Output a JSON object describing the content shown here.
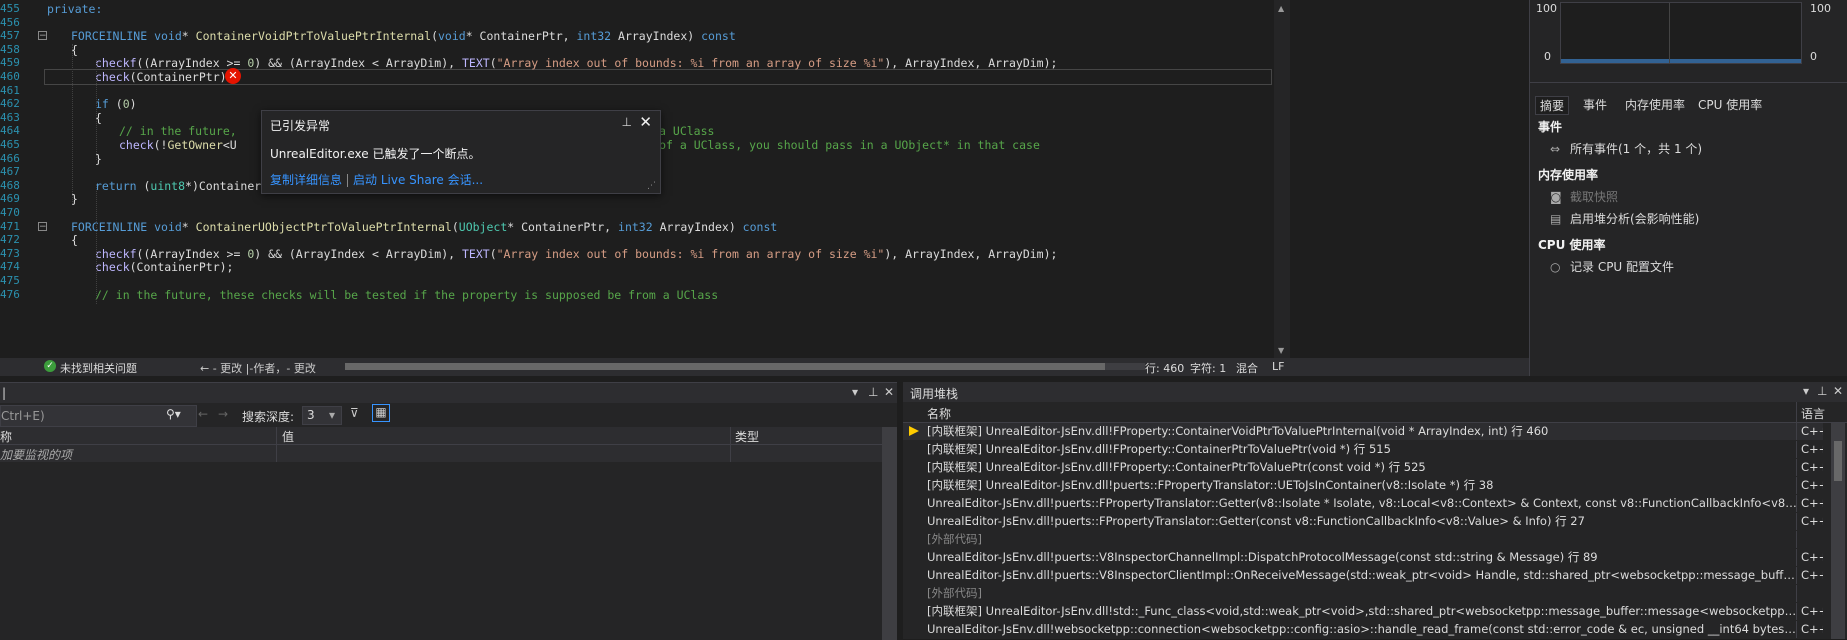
{
  "editor": {
    "line_numbers": [
      "455",
      "456",
      "457",
      "458",
      "459",
      "460",
      "461",
      "462",
      "463",
      "464",
      "465",
      "466",
      "467",
      "468",
      "469",
      "470",
      "471",
      "472",
      "473",
      "474",
      "475",
      "476"
    ],
    "lines": [
      {
        "indent": 0,
        "parts": [
          [
            "kw",
            "private:"
          ]
        ]
      },
      {
        "indent": 0,
        "parts": []
      },
      {
        "indent": 1,
        "parts": [
          [
            "kw",
            "FORCEINLINE "
          ],
          [
            "kw",
            "void"
          ],
          [
            "",
            "* "
          ],
          [
            "fn",
            "ContainerVoidPtrToValuePtrInternal"
          ],
          [
            "",
            "("
          ],
          [
            "kw",
            "void"
          ],
          [
            "",
            "* ContainerPtr, "
          ],
          [
            "kw",
            "int32"
          ],
          [
            "",
            " ArrayIndex) "
          ],
          [
            "kw",
            "const"
          ]
        ]
      },
      {
        "indent": 1,
        "parts": [
          [
            "",
            "{"
          ]
        ]
      },
      {
        "indent": 2,
        "parts": [
          [
            "mac",
            "checkf"
          ],
          [
            "",
            "((ArrayIndex >= "
          ],
          [
            "num",
            "0"
          ],
          [
            "",
            ") && (ArrayIndex < ArrayDim), "
          ],
          [
            "mac",
            "TEXT"
          ],
          [
            "",
            "("
          ],
          [
            "str",
            "\"Array index out of bounds: %i from an array of size %i\""
          ],
          [
            "",
            "), ArrayIndex, ArrayDim);"
          ]
        ]
      },
      {
        "indent": 2,
        "parts": [
          [
            "mac",
            "check"
          ],
          [
            "",
            "(ContainerPtr);"
          ]
        ]
      },
      {
        "indent": 0,
        "parts": []
      },
      {
        "indent": 2,
        "parts": [
          [
            "kw",
            "if"
          ],
          [
            "",
            " ("
          ],
          [
            "num",
            "0"
          ],
          [
            "",
            ")"
          ]
        ]
      },
      {
        "indent": 2,
        "parts": [
          [
            "",
            "{"
          ]
        ]
      },
      {
        "indent": 3,
        "parts": [
          [
            "cm",
            "// in the future, "
          ],
          [
            "",
            "                                                     "
          ],
          [
            "cm",
            "ive to a UClass"
          ]
        ]
      },
      {
        "indent": 3,
        "parts": [
          [
            "mac",
            "check"
          ],
          [
            "",
            "(!"
          ],
          [
            "fn",
            "GetOwner"
          ],
          [
            "",
            "<U"
          ],
          [
            "",
            "                                             "
          ],
          [
            "cm",
            " child property of a UClass, you should pass in a UObject* in that case"
          ]
        ]
      },
      {
        "indent": 2,
        "parts": [
          [
            "",
            "}"
          ]
        ]
      },
      {
        "indent": 0,
        "parts": []
      },
      {
        "indent": 2,
        "parts": [
          [
            "kw",
            "return"
          ],
          [
            "",
            " ("
          ],
          [
            "ty",
            "uint8"
          ],
          [
            "",
            "*)ContainerPtr + Offset_Internal + ElementSize * ArrayIndex;"
          ]
        ]
      },
      {
        "indent": 1,
        "parts": [
          [
            "",
            "}"
          ]
        ]
      },
      {
        "indent": 0,
        "parts": []
      },
      {
        "indent": 1,
        "parts": [
          [
            "kw",
            "FORCEINLINE "
          ],
          [
            "kw",
            "void"
          ],
          [
            "",
            "* "
          ],
          [
            "fn",
            "ContainerUObjectPtrToValuePtrInternal"
          ],
          [
            "",
            "("
          ],
          [
            "ty",
            "UObject"
          ],
          [
            "",
            "* ContainerPtr, "
          ],
          [
            "kw",
            "int32"
          ],
          [
            "",
            " ArrayIndex) "
          ],
          [
            "kw",
            "const"
          ]
        ]
      },
      {
        "indent": 1,
        "parts": [
          [
            "",
            "{"
          ]
        ]
      },
      {
        "indent": 2,
        "parts": [
          [
            "mac",
            "checkf"
          ],
          [
            "",
            "((ArrayIndex >= "
          ],
          [
            "num",
            "0"
          ],
          [
            "",
            ") && (ArrayIndex < ArrayDim), "
          ],
          [
            "mac",
            "TEXT"
          ],
          [
            "",
            "("
          ],
          [
            "str",
            "\"Array index out of bounds: %i from an array of size %i\""
          ],
          [
            "",
            "), ArrayIndex, ArrayDim);"
          ]
        ]
      },
      {
        "indent": 2,
        "parts": [
          [
            "mac",
            "check"
          ],
          [
            "",
            "(ContainerPtr);"
          ]
        ]
      },
      {
        "indent": 0,
        "parts": []
      },
      {
        "indent": 2,
        "parts": [
          [
            "cm",
            "// in the future, these checks will be tested if the property is supposed be from a UClass"
          ]
        ]
      }
    ]
  },
  "exception": {
    "title": "已引发异常",
    "message": "UnrealEditor.exe 已触发了一个断点。",
    "link_copy": "复制详细信息",
    "link_liveshare": "启动 Live Share 会话..."
  },
  "status": {
    "issues": "未找到相关问题",
    "changes": "← - 更改 |-作者，- 更改",
    "line": "行: 460",
    "col": "字符: 1",
    "mixed": "混合",
    "eol": "LF"
  },
  "diagnostics": {
    "graph_left_max": "100",
    "graph_left_min": "0",
    "graph_right_max": "100",
    "graph_right_min": "0",
    "tabs": [
      "摘要",
      "事件",
      "内存使用率",
      "CPU 使用率"
    ],
    "section_events": "事件",
    "all_events": "所有事件(1 个，共 1 个)",
    "section_memory": "内存使用率",
    "snapshot": "截取快照",
    "heap_profile": "启用堆分析(会影响性能)",
    "section_cpu": "CPU 使用率",
    "record_cpu": "记录 CPU 配置文件"
  },
  "watch": {
    "search_placeholder": "Ctrl+E)",
    "search_depth_label": "搜索深度:",
    "search_depth_value": "3",
    "col_name": "称",
    "col_value": "值",
    "col_type": "类型",
    "add_item": "加要监视的项"
  },
  "callstack": {
    "title": "调用堆栈",
    "col_name": "名称",
    "col_lang": "语言",
    "rows": [
      {
        "name": "[内联框架] UnrealEditor-JsEnv.dll!FProperty::ContainerVoidPtrToValuePtrInternal(void * ArrayIndex, int) 行 460",
        "lang": "C++",
        "current": true,
        "ext": false
      },
      {
        "name": "[内联框架] UnrealEditor-JsEnv.dll!FProperty::ContainerPtrToValuePtr(void *) 行 515",
        "lang": "C++",
        "current": false,
        "ext": false
      },
      {
        "name": "[内联框架] UnrealEditor-JsEnv.dll!FProperty::ContainerPtrToValuePtr(const void *) 行 525",
        "lang": "C++",
        "current": false,
        "ext": false
      },
      {
        "name": "[内联框架] UnrealEditor-JsEnv.dll!puerts::FPropertyTranslator::UEToJsInContainer(v8::Isolate *) 行 38",
        "lang": "C++",
        "current": false,
        "ext": false
      },
      {
        "name": "UnrealEditor-JsEnv.dll!puerts::FPropertyTranslator::Getter(v8::Isolate * Isolate, v8::Local<v8::Context> & Context, const v8::FunctionCallbackInfo<v8::Value> & Info) ...",
        "lang": "C++",
        "current": false,
        "ext": false
      },
      {
        "name": "UnrealEditor-JsEnv.dll!puerts::FPropertyTranslator::Getter(const v8::FunctionCallbackInfo<v8::Value> & Info) 行 27",
        "lang": "C++",
        "current": false,
        "ext": false
      },
      {
        "name": "[外部代码]",
        "lang": "",
        "current": false,
        "ext": true
      },
      {
        "name": "UnrealEditor-JsEnv.dll!puerts::V8InspectorChannelImpl::DispatchProtocolMessage(const std::string & Message) 行 89",
        "lang": "C++",
        "current": false,
        "ext": false
      },
      {
        "name": "UnrealEditor-JsEnv.dll!puerts::V8InspectorClientImpl::OnReceiveMessage(std::weak_ptr<void> Handle, std::shared_ptr<websocketpp::message_buffer::message<we...",
        "lang": "C++",
        "current": false,
        "ext": false
      },
      {
        "name": "[外部代码]",
        "lang": "",
        "current": false,
        "ext": true
      },
      {
        "name": "[内联框架] UnrealEditor-JsEnv.dll!std::_Func_class<void,std::weak_ptr<void>,std::shared_ptr<websocketpp::message_buffer::message<websocketpp::message_buff...",
        "lang": "C++",
        "current": false,
        "ext": false
      },
      {
        "name": "UnrealEditor-JsEnv.dll!websocketpp::connection<websocketpp::config::asio>::handle_read_frame(const std::error_code & ec, unsigned __int64 bytes_transferred) 行...",
        "lang": "C++",
        "current": false,
        "ext": false
      }
    ]
  }
}
